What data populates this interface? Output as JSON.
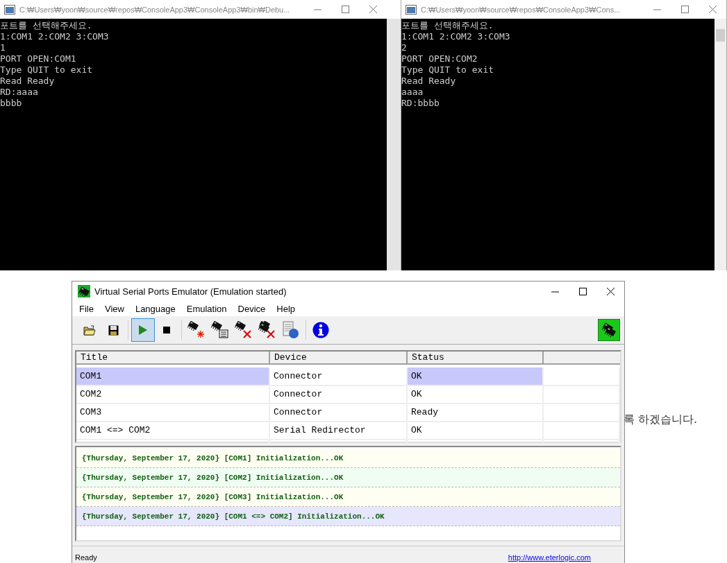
{
  "background_text": "록 하겠습니다.",
  "consoles": [
    {
      "title": "C:₩Users₩yoon₩source₩repos₩ConsoleApp3₩ConsoleApp3₩bin₩Debu...",
      "lines": [
        "포트를 선택해주세요.",
        "1:COM1 2:COM2 3:COM3",
        "1",
        "PORT OPEN:COM1",
        "Type QUIT to exit",
        "Read Ready",
        "RD:aaaa",
        "bbbb"
      ]
    },
    {
      "title": "C:₩Users₩yoon₩source₩repos₩ConsoleApp3₩Cons...",
      "lines": [
        "포트를 선택해주세요.",
        "1:COM1 2:COM2 3:COM3",
        "2",
        "PORT OPEN:COM2",
        "Type QUIT to exit",
        "Read Ready",
        "aaaa",
        "RD:bbbb"
      ]
    }
  ],
  "emulator": {
    "title": "Virtual Serial Ports Emulator (Emulation started)",
    "menu": [
      "File",
      "View",
      "Language",
      "Emulation",
      "Device",
      "Help"
    ],
    "toolbar": [
      {
        "kind": "open",
        "pressed": false
      },
      {
        "kind": "save",
        "pressed": false
      },
      {
        "kind": "separator"
      },
      {
        "kind": "start",
        "pressed": true
      },
      {
        "kind": "stop",
        "pressed": false
      },
      {
        "kind": "separator"
      },
      {
        "kind": "device-new",
        "pressed": false
      },
      {
        "kind": "device-props",
        "pressed": false
      },
      {
        "kind": "device-delete",
        "pressed": false
      },
      {
        "kind": "device-delete-all",
        "pressed": false
      },
      {
        "kind": "options",
        "pressed": false
      },
      {
        "kind": "separator"
      },
      {
        "kind": "info",
        "pressed": false
      }
    ],
    "table": {
      "columns": [
        "Title",
        "Device",
        "Status"
      ],
      "rows": [
        {
          "title": "COM1",
          "device": "Connector",
          "status": "OK",
          "selected": true
        },
        {
          "title": "COM2",
          "device": "Connector",
          "status": "OK",
          "selected": false
        },
        {
          "title": "COM3",
          "device": "Connector",
          "status": "Ready",
          "selected": false
        },
        {
          "title": "COM1 <=> COM2",
          "device": "Serial Redirector",
          "status": "OK",
          "selected": false
        }
      ]
    },
    "log": [
      {
        "text": "{Thursday, September 17, 2020} [COM1] Initialization...OK",
        "color": "#fefef2"
      },
      {
        "text": "{Thursday, September 17, 2020} [COM2] Initialization...OK",
        "color": "#f0fdf2"
      },
      {
        "text": "{Thursday, September 17, 2020} [COM3] Initialization...OK",
        "color": "#fefef2"
      },
      {
        "text": "{Thursday, September 17, 2020} [COM1 <=> COM2] Initialization...OK",
        "color": "#e6e6fc"
      }
    ],
    "status_bar": {
      "text": "Ready",
      "link": "http://www.eterlogic.com"
    }
  }
}
